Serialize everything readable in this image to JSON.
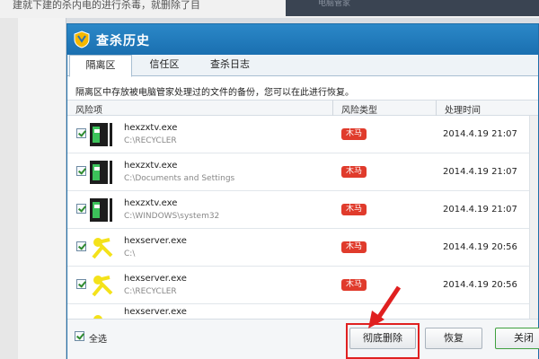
{
  "window": {
    "title": "查杀历史"
  },
  "background": {
    "top_text": "建就下建的杀内电的进行杀毒，就删除了目",
    "dark_text": "电脑管家"
  },
  "tabs": [
    {
      "label": "隔离区",
      "active": true
    },
    {
      "label": "信任区",
      "active": false
    },
    {
      "label": "查杀日志",
      "active": false
    }
  ],
  "info_text": "隔离区中存放被电脑管家处理过的文件的备份，您可以在此进行恢复。",
  "columns": {
    "item": "风险项",
    "type": "风险类型",
    "time": "处理时间"
  },
  "rows": [
    {
      "name": "hexzxtv.exe",
      "path": "C:\\RECYCLER",
      "risk": "木马",
      "time": "2014.4.19 21:07",
      "icon": "program-icon"
    },
    {
      "name": "hexzxtv.exe",
      "path": "C:\\Documents and Settings",
      "risk": "木马",
      "time": "2014.4.19 21:07",
      "icon": "program-icon"
    },
    {
      "name": "hexzxtv.exe",
      "path": "C:\\WINDOWS\\system32",
      "risk": "木马",
      "time": "2014.4.19 21:07",
      "icon": "program-icon"
    },
    {
      "name": "hexserver.exe",
      "path": "C:\\",
      "risk": "木马",
      "time": "2014.4.19 20:56",
      "icon": "satellite-icon"
    },
    {
      "name": "hexserver.exe",
      "path": "C:\\RECYCLER",
      "risk": "木马",
      "time": "2014.4.19 20:56",
      "icon": "satellite-icon"
    },
    {
      "name": "hexserver.exe",
      "path": "",
      "risk": "",
      "time": "",
      "icon": "satellite-icon"
    }
  ],
  "footer": {
    "select_all": "全选",
    "delete_label": "彻底删除",
    "restore_label": "恢复",
    "close_label": "关闭"
  },
  "colors": {
    "titlebar": "#1a6fb0",
    "risk_badge": "#e03b2c",
    "highlight": "#e02020"
  }
}
